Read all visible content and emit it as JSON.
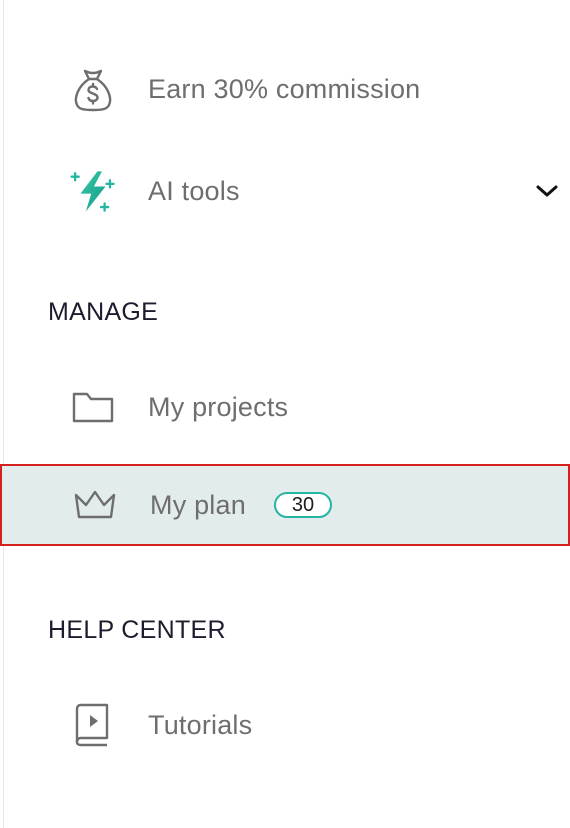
{
  "sidebar": {
    "top_items": [
      {
        "label": "Earn 30% commission",
        "icon": "money-bag-icon"
      },
      {
        "label": "AI tools",
        "icon": "sparkle-bolt-icon",
        "expand_icon": "chevron-down-icon"
      }
    ],
    "manage": {
      "heading": "MANAGE",
      "items": [
        {
          "label": "My projects",
          "icon": "folder-icon"
        },
        {
          "label": "My plan",
          "icon": "crown-icon",
          "badge": "30",
          "selected": true
        }
      ]
    },
    "help_center": {
      "heading": "HELP CENTER",
      "items": [
        {
          "label": "Tutorials",
          "icon": "video-book-icon"
        }
      ]
    }
  },
  "colors": {
    "accent": "#26b5a0",
    "selected_background": "#e3ecec",
    "selection_outline": "#d61f1f",
    "label_text": "#6e6e6e",
    "heading_text": "#1c1c2e"
  }
}
